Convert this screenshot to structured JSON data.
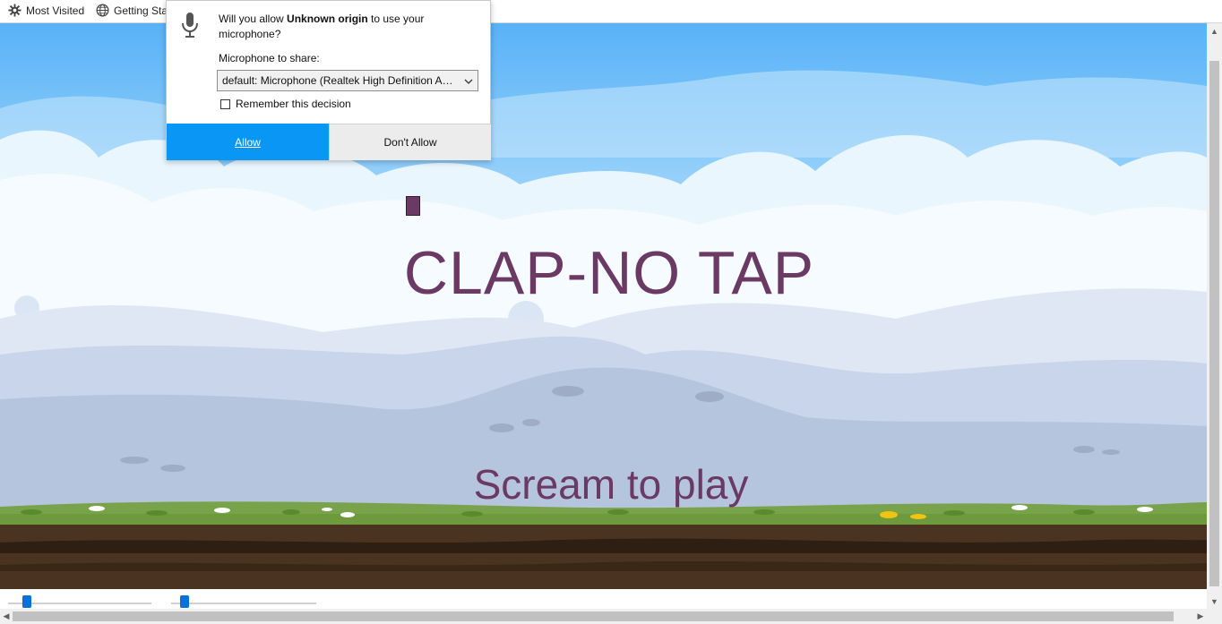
{
  "bookmarks": {
    "items": [
      {
        "label": "Most Visited",
        "icon": "gear-icon"
      },
      {
        "label": "Getting Started",
        "icon": "globe-icon"
      }
    ]
  },
  "game": {
    "title": "CLAP-NO TAP",
    "subtitle": "Scream to play",
    "text_color": "#6a3a64",
    "sky_color": "#5ab4f8"
  },
  "permission_popup": {
    "question_prefix": "Will you allow ",
    "origin": "Unknown origin",
    "question_suffix": " to use your microphone?",
    "share_label": "Microphone to share:",
    "selected_device": "default: Microphone (Realtek High Definition Audio)",
    "remember_label": "Remember this decision",
    "remember_checked": false,
    "allow_label": "Allow",
    "deny_label": "Don't Allow",
    "allow_color": "#0a96f5",
    "icon": "microphone-icon"
  }
}
